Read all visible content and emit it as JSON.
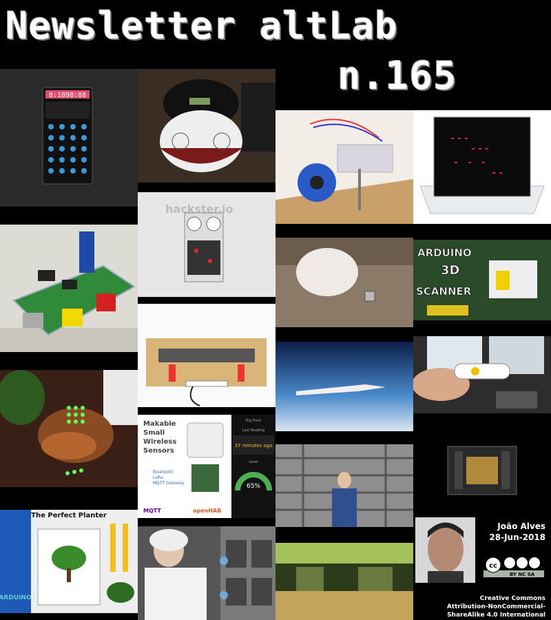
{
  "header": {
    "title": "Newsletter altLab",
    "issue": "n.165"
  },
  "author": {
    "name": "João Alves",
    "date": "28-Jun-2018"
  },
  "license": {
    "line1": "Creative Commons",
    "line2": "Attribution-NonCommercial-",
    "line3": "ShareAlike 4.0 International",
    "badge": "BY NC SA",
    "badge_cc": "cc"
  },
  "tiles": {
    "scanner_title": "ARDUINO 3D SCANNER",
    "sensors_title": "Makable Small Wireless Sensors",
    "sensors_protocols": "Bluetooth LoRa MQTT Gateway",
    "sensors_time": "37 minutes ago",
    "sensors_level": "65%",
    "sensors_label_top": "Rig Front",
    "sensors_label_mid": "Last Reading",
    "sensors_label_low": "Level",
    "sensors_brand": "MQTT",
    "sensors_brand2": "openHAB",
    "planter_title": "The Perfect Planter",
    "planter_brand": "ARDUINO",
    "hackster": "hackster.io",
    "calc_display": "8:1898:88"
  }
}
